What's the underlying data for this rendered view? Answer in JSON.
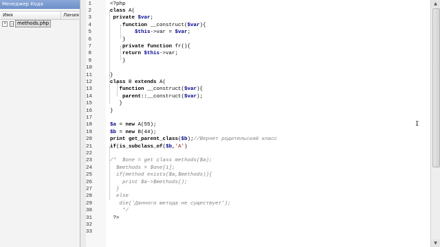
{
  "code_manager": {
    "title": "Менеджер Кода",
    "columns": {
      "name": "Имя",
      "line": "Линия"
    },
    "tree": [
      {
        "expand_glyph": "+",
        "label": "methods.php"
      }
    ]
  },
  "editor": {
    "lines": [
      {
        "n": "1",
        "segments": [
          {
            "t": "<?php",
            "c": "phptag"
          }
        ]
      },
      {
        "n": "2",
        "segments": [
          {
            "t": "class ",
            "c": "kw"
          },
          {
            "t": "A(",
            "c": "fn"
          }
        ]
      },
      {
        "n": "3",
        "segments": [
          {
            "t": " private ",
            "c": "kw"
          },
          {
            "t": "$var",
            "c": "var"
          },
          {
            "t": ";",
            "c": "fn"
          }
        ]
      },
      {
        "n": "4",
        "segments": [
          {
            "t": "    function ",
            "c": "kw"
          },
          {
            "t": "__construct(",
            "c": "fn"
          },
          {
            "t": "$var",
            "c": "var"
          },
          {
            "t": "){",
            "c": "fn"
          }
        ]
      },
      {
        "n": "5",
        "segments": [
          {
            "t": "        ",
            "c": "fn"
          },
          {
            "t": "$this",
            "c": "var"
          },
          {
            "t": "->var = ",
            "c": "fn"
          },
          {
            "t": "$var",
            "c": "var"
          },
          {
            "t": ";",
            "c": "fn"
          }
        ]
      },
      {
        "n": "6",
        "segments": [
          {
            "t": "    }",
            "c": "fn"
          }
        ]
      },
      {
        "n": "7",
        "segments": [
          {
            "t": "    private function ",
            "c": "kw"
          },
          {
            "t": "fr(){",
            "c": "fn"
          }
        ]
      },
      {
        "n": "8",
        "segments": [
          {
            "t": "    return ",
            "c": "kw"
          },
          {
            "t": "$this",
            "c": "var"
          },
          {
            "t": "->var;",
            "c": "fn"
          }
        ]
      },
      {
        "n": "9",
        "segments": [
          {
            "t": "    }",
            "c": "fn"
          }
        ]
      },
      {
        "n": "10",
        "segments": [
          {
            "t": "",
            "c": "fn"
          }
        ]
      },
      {
        "n": "11",
        "segments": [
          {
            "t": "}",
            "c": "fn"
          }
        ]
      },
      {
        "n": "12",
        "segments": [
          {
            "t": "class ",
            "c": "kw"
          },
          {
            "t": "B ",
            "c": "fn"
          },
          {
            "t": "extends ",
            "c": "kw"
          },
          {
            "t": "A(",
            "c": "fn"
          }
        ]
      },
      {
        "n": "13",
        "segments": [
          {
            "t": "   function ",
            "c": "kw"
          },
          {
            "t": "__construct(",
            "c": "fn"
          },
          {
            "t": "$var",
            "c": "var"
          },
          {
            "t": "){",
            "c": "fn"
          }
        ]
      },
      {
        "n": "14",
        "segments": [
          {
            "t": "    parent::",
            "c": "kw"
          },
          {
            "t": "__construct(",
            "c": "fn"
          },
          {
            "t": "$var",
            "c": "var"
          },
          {
            "t": ");",
            "c": "fn"
          }
        ]
      },
      {
        "n": "15",
        "segments": [
          {
            "t": "   }",
            "c": "fn"
          }
        ]
      },
      {
        "n": "16",
        "segments": [
          {
            "t": "}",
            "c": "fn"
          }
        ]
      },
      {
        "n": "17",
        "segments": [
          {
            "t": "",
            "c": "fn"
          }
        ]
      },
      {
        "n": "18",
        "segments": [
          {
            "t": "$a",
            "c": "var"
          },
          {
            "t": " = ",
            "c": "fn"
          },
          {
            "t": "new ",
            "c": "kw"
          },
          {
            "t": "A(55);",
            "c": "fn"
          }
        ]
      },
      {
        "n": "19",
        "segments": [
          {
            "t": "$b",
            "c": "var"
          },
          {
            "t": " = ",
            "c": "fn"
          },
          {
            "t": "new ",
            "c": "kw"
          },
          {
            "t": "B(44);",
            "c": "fn"
          }
        ]
      },
      {
        "n": "20",
        "segments": [
          {
            "t": "print ",
            "c": "kw"
          },
          {
            "t": "get_parent_class",
            "c": "kw"
          },
          {
            "t": "(",
            "c": "fn"
          },
          {
            "t": "$b",
            "c": "var"
          },
          {
            "t": ");",
            "c": "fn"
          },
          {
            "t": "//Вернет родительский класс",
            "c": "cmt"
          }
        ]
      },
      {
        "n": "21",
        "segments": [
          {
            "t": "if",
            "c": "kw"
          },
          {
            "t": "(",
            "c": "fn"
          },
          {
            "t": "is_subclass_of",
            "c": "kw"
          },
          {
            "t": "(",
            "c": "fn"
          },
          {
            "t": "$b",
            "c": "var"
          },
          {
            "t": ",",
            "c": "fn"
          },
          {
            "t": "'A'",
            "c": "str"
          },
          {
            "t": ")",
            "c": "fn"
          }
        ]
      },
      {
        "n": "22",
        "segments": [
          {
            "t": "",
            "c": "fn"
          }
        ]
      },
      {
        "n": "23",
        "segments": [
          {
            "t": "/*  $one = get class methods($a);",
            "c": "cmt"
          }
        ]
      },
      {
        "n": "24",
        "segments": [
          {
            "t": "  $methods = $one[1];",
            "c": "cmt"
          }
        ]
      },
      {
        "n": "25",
        "segments": [
          {
            "t": "  if(method exists($a,$methods)){",
            "c": "cmt"
          }
        ]
      },
      {
        "n": "26",
        "segments": [
          {
            "t": "    print $a->$methods();",
            "c": "cmt"
          }
        ]
      },
      {
        "n": "27",
        "segments": [
          {
            "t": "  }",
            "c": "cmt"
          }
        ]
      },
      {
        "n": "28",
        "segments": [
          {
            "t": "  else",
            "c": "cmt"
          }
        ]
      },
      {
        "n": "29",
        "segments": [
          {
            "t": "   die('Данного метода не существует');",
            "c": "cmt"
          }
        ]
      },
      {
        "n": "30",
        "segments": [
          {
            "t": "    */",
            "c": "cmt"
          }
        ]
      },
      {
        "n": "31",
        "segments": [
          {
            "t": " ?>",
            "c": "phptag"
          }
        ]
      },
      {
        "n": "32",
        "segments": [
          {
            "t": "",
            "c": "fn"
          }
        ]
      },
      {
        "n": "33",
        "segments": [
          {
            "t": "",
            "c": "fn"
          }
        ]
      }
    ]
  },
  "icons": {
    "expand": "plus-expand-icon",
    "file": "php-file-icon",
    "scroll_up": "scroll-up-arrow-icon",
    "scroll_down": "scroll-down-arrow-icon",
    "cursor": "i-beam-cursor-icon"
  },
  "colors": {
    "panel_title_bg": "#6c8fc8",
    "variable": "#00008b",
    "comment": "#808080",
    "string": "#a31515"
  }
}
